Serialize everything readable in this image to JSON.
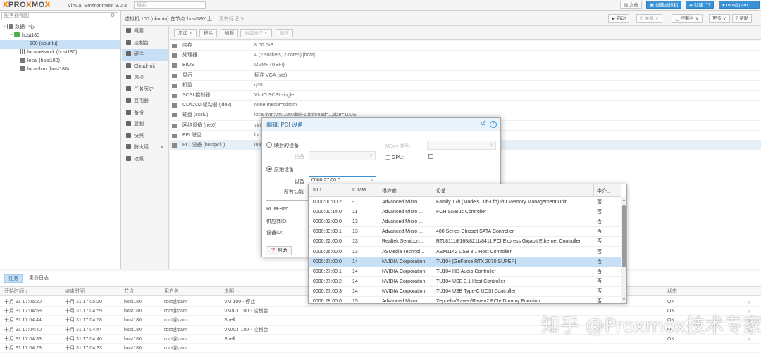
{
  "topbar": {
    "logo_prefix": "PRO",
    "logo_x": "X",
    "logo_mid": "MO",
    "logo_end": "X",
    "version": "Virtual Environment 9.0.3",
    "search_placeholder": "搜索",
    "docs": "文档",
    "create_vm": "创建虚拟机",
    "create_ct": "创建 CT",
    "user": "root@pam"
  },
  "tree": {
    "view": "服务器视图",
    "items": [
      {
        "label": "数据中心"
      },
      {
        "label": "host180"
      },
      {
        "label": "100 (ubuntu)"
      },
      {
        "label": "localnetwork (host180)"
      },
      {
        "label": "local (host180)"
      },
      {
        "label": "local-lvm (host180)"
      }
    ]
  },
  "vmhead": {
    "title": "虚拟机 100 (ubuntu) 在节点 'host180' 上",
    "tag": "没有标记",
    "start": "启动",
    "shutdown": "关机",
    "console": "控制台",
    "more": "更多",
    "help": "帮助"
  },
  "submenu": [
    "概要",
    "控制台",
    "硬件",
    "Cloud-Init",
    "选项",
    "任务历史",
    "监视器",
    "备份",
    "复制",
    "快照",
    "防火墙",
    "权限"
  ],
  "hwtoolbar": [
    "添加",
    "移除",
    "编辑",
    "磁盘操作",
    "还原"
  ],
  "hardware": [
    {
      "k": "内存",
      "v": "8.00 GiB"
    },
    {
      "k": "处理器",
      "v": "4 (2 sockets, 2 cores) [host]"
    },
    {
      "k": "BIOS",
      "v": "OVMF (UEFI)"
    },
    {
      "k": "显示",
      "v": "标准 VGA (std)"
    },
    {
      "k": "机型",
      "v": "q35"
    },
    {
      "k": "SCSI 控制器",
      "v": "VirtIO SCSI single"
    },
    {
      "k": "CD/DVD 驱动器 (ide2)",
      "v": "none,media=cdrom"
    },
    {
      "k": "硬盘 (scsi0)",
      "v": "local-lvm:vm-100-disk-1,iothread=1,size=100G"
    },
    {
      "k": "网络设备 (net0)",
      "v": "virtio=..."
    },
    {
      "k": "EFI 磁盘",
      "v": "local-lvm:..."
    },
    {
      "k": "PCI 设备 (hostpci0)",
      "v": "0000:27:00,pcie=1"
    }
  ],
  "dialog": {
    "title": "编辑: PCI 设备",
    "mapped": "映射的设备",
    "device_label": "设备",
    "mdev": "MDev 类型:",
    "primary_gpu": "主 GPU:",
    "raw": "原始设备",
    "device_value": "0000:27:00.0",
    "all_functions": "所有功能:",
    "rombar": "ROM-Bar:",
    "vendor_id": "供应商ID:",
    "device_id": "设备ID:",
    "help": "帮助"
  },
  "dropdown": {
    "headers": [
      "ID ↑",
      "IOMM...",
      "供应商",
      "设备",
      "中介..."
    ],
    "rows": [
      {
        "id": "0000:00:00.2",
        "iommu": "-",
        "vendor": "Advanced Micro ...",
        "device": "Family 17h (Models 00h-0fh) I/O Memory Management Unit",
        "mdev": "否"
      },
      {
        "id": "0000:00:14.0",
        "iommu": "11",
        "vendor": "Advanced Micro ...",
        "device": "FCH SMBus Controller",
        "mdev": "否"
      },
      {
        "id": "0000:03:00.0",
        "iommu": "13",
        "vendor": "Advanced Micro ...",
        "device": "",
        "mdev": "否"
      },
      {
        "id": "0000:03:00.1",
        "iommu": "13",
        "vendor": "Advanced Micro ...",
        "device": "400 Series Chipset SATA Controller",
        "mdev": "否"
      },
      {
        "id": "0000:22:00.0",
        "iommu": "13",
        "vendor": "Realtek Semicon...",
        "device": "RTL8111/8168/8211/8411 PCI Express Gigabit Ethernet Controller",
        "mdev": "否"
      },
      {
        "id": "0000:26:00.0",
        "iommu": "13",
        "vendor": "ASMedia Technol...",
        "device": "ASM1142 USB 3.1 Host Controller",
        "mdev": "否"
      },
      {
        "id": "0000:27:00.0",
        "iommu": "14",
        "vendor": "NVIDIA Corporation",
        "device": "TU104 [GeForce RTX 2070 SUPER]",
        "mdev": "否"
      },
      {
        "id": "0000:27:00.1",
        "iommu": "14",
        "vendor": "NVIDIA Corporation",
        "device": "TU104 HD Audio Controller",
        "mdev": "否"
      },
      {
        "id": "0000:27:00.2",
        "iommu": "14",
        "vendor": "NVIDIA Corporation",
        "device": "TU104 USB 3.1 Host Controller",
        "mdev": "否"
      },
      {
        "id": "0000:27:00.3",
        "iommu": "14",
        "vendor": "NVIDIA Corporation",
        "device": "TU104 USB Type-C UCSI Controller",
        "mdev": "否"
      },
      {
        "id": "0000:28:00.0",
        "iommu": "15",
        "vendor": "Advanced Micro ...",
        "device": "Zeppelin/Raven/Raven2 PCIe Dummy Function",
        "mdev": "否"
      }
    ]
  },
  "tasks": {
    "tab_tasks": "任务",
    "tab_cluster": "集群日志",
    "headers": [
      "开始时间 ↓",
      "结束时间",
      "节点",
      "用户名",
      "说明",
      "状态"
    ],
    "rows": [
      {
        "start": "十月 31 17:05:20",
        "end": "十月 31 17:05:20",
        "node": "host180",
        "user": "root@pam",
        "desc": "VM 100 - 停止",
        "status": "OK"
      },
      {
        "start": "十月 31 17:04:58",
        "end": "十月 31 17:04:59",
        "node": "host180",
        "user": "root@pam",
        "desc": "VM/CT 100 - 控制台",
        "status": "OK"
      },
      {
        "start": "十月 31 17:04:44",
        "end": "十月 31 17:04:58",
        "node": "host180",
        "user": "root@pam",
        "desc": "Shell",
        "status": "OK"
      },
      {
        "start": "十月 31 17:04:40",
        "end": "十月 31 17:04:44",
        "node": "host180",
        "user": "root@pam",
        "desc": "VM/CT 100 - 控制台",
        "status": "OK"
      },
      {
        "start": "十月 31 17:04:33",
        "end": "十月 31 17:04:40",
        "node": "host180",
        "user": "root@pam",
        "desc": "Shell",
        "status": "OK"
      },
      {
        "start": "十月 31 17:04:23",
        "end": "十月 31 17:04:33",
        "node": "host180",
        "user": "root@pam",
        "desc": "",
        "status": ""
      }
    ]
  },
  "watermark": "知乎 @Proxmox技术专家",
  "colors": {
    "accent": "#3892d4",
    "brand": "#e57000",
    "selected": "#c7e0f5"
  }
}
